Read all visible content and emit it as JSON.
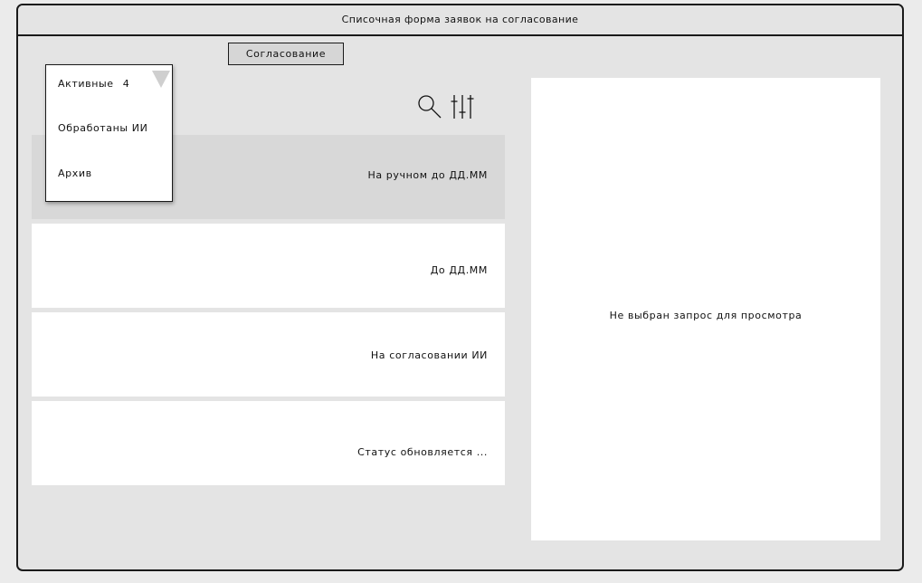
{
  "window": {
    "title": "Списочная форма заявок на согласование"
  },
  "toolbar": {
    "tab_label": "Согласование",
    "search_icon": "search-icon",
    "filter_icon": "sliders-icon"
  },
  "dropdown": {
    "selected_label": "Активные",
    "selected_count": "4",
    "items": [
      {
        "label": "Обработаны ИИ"
      },
      {
        "label": "Архив"
      }
    ],
    "caret_icon": "dropdown-caret-icon"
  },
  "requests": [
    {
      "status": "На ручном до ДД.ММ",
      "selected": true
    },
    {
      "status": "До ДД.ММ",
      "selected": false
    },
    {
      "status": "На согласовании ИИ",
      "selected": false
    },
    {
      "status": "Статус обновляется ...",
      "selected": false
    }
  ],
  "detail": {
    "empty_text": "Не выбран запрос для просмотра"
  },
  "colors": {
    "background": "#e4e4e4",
    "card": "#ffffff",
    "card_selected": "#d8d8d8",
    "border": "#1a1a1a"
  }
}
